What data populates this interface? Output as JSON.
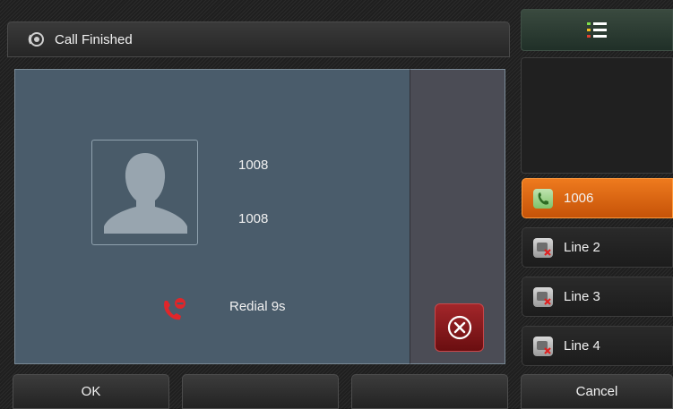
{
  "header": {
    "title": "Call Finished",
    "icon": "speaker-icon"
  },
  "call": {
    "name": "1008",
    "number": "1008",
    "status": "Redial 9s",
    "status_icon": "redial-icon"
  },
  "lines": [
    {
      "label": "1006",
      "state": "active",
      "icon": "phone-icon"
    },
    {
      "label": "Line 2",
      "state": "unregistered",
      "icon": "line-unregistered-icon"
    },
    {
      "label": "Line 3",
      "state": "unregistered",
      "icon": "line-unregistered-icon"
    },
    {
      "label": "Line 4",
      "state": "unregistered",
      "icon": "line-unregistered-icon"
    }
  ],
  "softkeys": {
    "key1": "OK",
    "key2": "",
    "key3": "",
    "key4": "Cancel"
  },
  "colors": {
    "accent": "#e06a12",
    "panel": "#4a5c6b",
    "close": "#a3262a"
  }
}
